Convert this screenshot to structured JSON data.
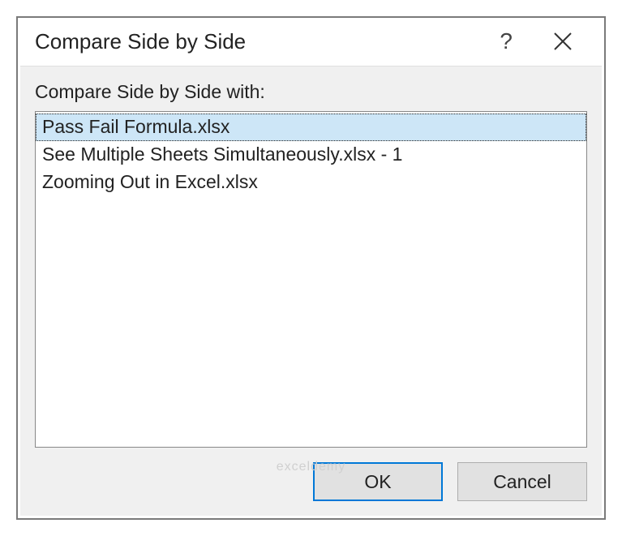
{
  "dialog": {
    "title": "Compare Side by Side",
    "help_symbol": "?",
    "label": "Compare Side by Side with:",
    "items": [
      {
        "label": "Pass Fail Formula.xlsx",
        "selected": true
      },
      {
        "label": "See Multiple Sheets Simultaneously.xlsx  -  1",
        "selected": false
      },
      {
        "label": "Zooming Out in Excel.xlsx",
        "selected": false
      }
    ],
    "buttons": {
      "ok": "OK",
      "cancel": "Cancel"
    }
  },
  "watermark": "exceldemy"
}
